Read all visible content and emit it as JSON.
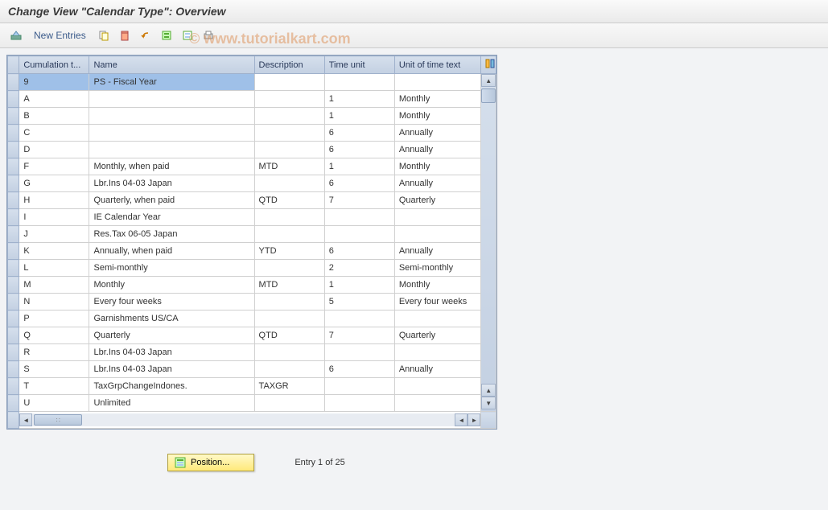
{
  "title": "Change View \"Calendar Type\": Overview",
  "watermark": "© www.tutorialkart.com",
  "toolbar": {
    "new_entries": "New Entries"
  },
  "columns": {
    "cumulation": "Cumulation t...",
    "name": "Name",
    "description": "Description",
    "time_unit": "Time unit",
    "unit_text": "Unit of time text"
  },
  "rows": [
    {
      "c": "9",
      "name": "PS - Fiscal Year",
      "desc": "",
      "time": "",
      "unit": "",
      "selected": true
    },
    {
      "c": "A",
      "name": "",
      "desc": "",
      "time": "1",
      "unit": "Monthly"
    },
    {
      "c": "B",
      "name": "",
      "desc": "",
      "time": "1",
      "unit": "Monthly"
    },
    {
      "c": "C",
      "name": "",
      "desc": "",
      "time": "6",
      "unit": "Annually"
    },
    {
      "c": "D",
      "name": "",
      "desc": "",
      "time": "6",
      "unit": "Annually"
    },
    {
      "c": "F",
      "name": "Monthly, when paid",
      "desc": "MTD",
      "time": "1",
      "unit": "Monthly"
    },
    {
      "c": "G",
      "name": "Lbr.Ins 04-03  Japan",
      "desc": "",
      "time": "6",
      "unit": "Annually"
    },
    {
      "c": "H",
      "name": "Quarterly, when paid",
      "desc": "QTD",
      "time": "7",
      "unit": "Quarterly"
    },
    {
      "c": "I",
      "name": "IE Calendar Year",
      "desc": "",
      "time": "",
      "unit": ""
    },
    {
      "c": "J",
      "name": "Res.Tax 06-05  Japan",
      "desc": "",
      "time": "",
      "unit": ""
    },
    {
      "c": "K",
      "name": "Annually, when paid",
      "desc": "YTD",
      "time": "6",
      "unit": "Annually"
    },
    {
      "c": "L",
      "name": "Semi-monthly",
      "desc": "",
      "time": "2",
      "unit": "Semi-monthly"
    },
    {
      "c": "M",
      "name": "Monthly",
      "desc": "MTD",
      "time": "1",
      "unit": "Monthly"
    },
    {
      "c": "N",
      "name": "Every four weeks",
      "desc": "",
      "time": "5",
      "unit": "Every four weeks"
    },
    {
      "c": "P",
      "name": "Garnishments US/CA",
      "desc": "",
      "time": "",
      "unit": ""
    },
    {
      "c": "Q",
      "name": "Quarterly",
      "desc": "QTD",
      "time": "7",
      "unit": "Quarterly"
    },
    {
      "c": "R",
      "name": "Lbr.Ins 04-03  Japan",
      "desc": "",
      "time": "",
      "unit": ""
    },
    {
      "c": "S",
      "name": "Lbr.Ins 04-03  Japan",
      "desc": "",
      "time": "6",
      "unit": "Annually"
    },
    {
      "c": "T",
      "name": "TaxGrpChangeIndones.",
      "desc": "TAXGR",
      "time": "",
      "unit": ""
    },
    {
      "c": "U",
      "name": "Unlimited",
      "desc": "",
      "time": "",
      "unit": ""
    }
  ],
  "bottom": {
    "position": "Position...",
    "entry": "Entry 1 of 25"
  }
}
